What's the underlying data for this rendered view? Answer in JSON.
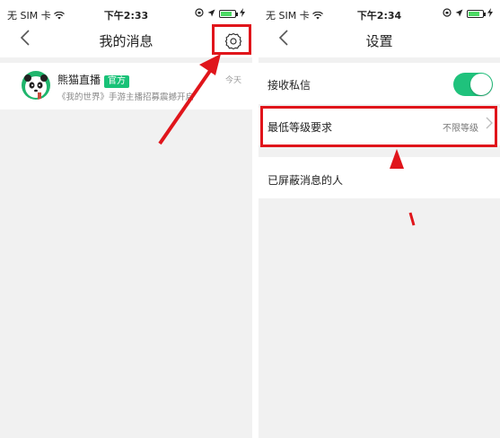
{
  "left": {
    "status": {
      "carrier": "无 SIM 卡",
      "time": "下午2:33"
    },
    "nav": {
      "title": "我的消息"
    },
    "message": {
      "name": "熊猫直播",
      "badge": "官方",
      "preview": "《我的世界》手游主播招募震撼开启",
      "time": "今天"
    }
  },
  "right": {
    "status": {
      "carrier": "无 SIM 卡",
      "time": "下午2:34"
    },
    "nav": {
      "title": "设置"
    },
    "rows": {
      "receive": {
        "label": "接收私信",
        "toggle_on": true
      },
      "level": {
        "label": "最低等级要求",
        "value": "不限等级"
      },
      "blocked": {
        "label": "已屏蔽消息的人"
      }
    }
  },
  "colors": {
    "accent_green": "#1fc27c",
    "highlight_red": "#e0151b",
    "background_gray": "#f1f1f1"
  },
  "icons": [
    "wifi-icon",
    "location-icon",
    "battery-icon",
    "back-icon",
    "gear-icon",
    "chevron-right-icon",
    "panda-avatar"
  ]
}
